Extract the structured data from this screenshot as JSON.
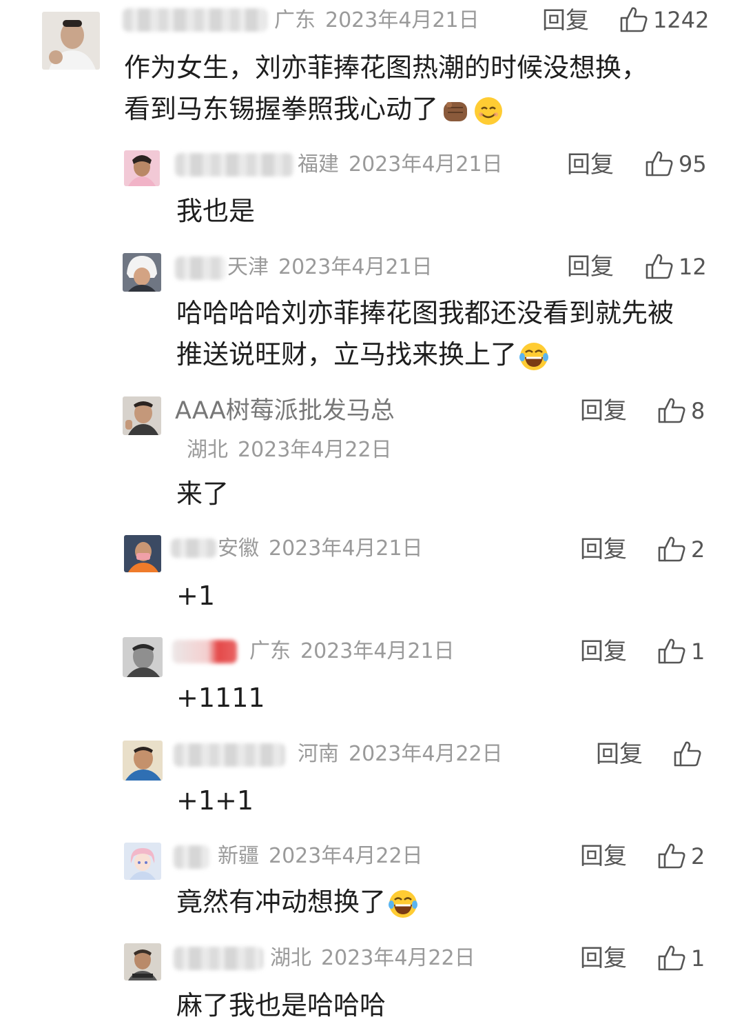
{
  "comments": [
    {
      "region": "广东",
      "date": "2023年4月21日",
      "reply": "回复",
      "likes": "1242",
      "lines": [
        "作为女生，刘亦菲捧花图热潮的时候没想换，",
        "看到马东锡握拳照我心动了"
      ],
      "emojis": [
        "fist-emoji",
        "smile-emoji"
      ]
    },
    {
      "region": "福建",
      "date": "2023年4月21日",
      "reply": "回复",
      "likes": "95",
      "lines": [
        "我也是"
      ]
    },
    {
      "region": "天津",
      "date": "2023年4月21日",
      "reply": "回复",
      "likes": "12",
      "lines": [
        "哈哈哈哈刘亦菲捧花图我都还没看到就先被",
        "推送说旺财，立马找来换上了"
      ],
      "emojis": [
        "laugh-cry-emoji"
      ]
    },
    {
      "name": "AAA树莓派批发马总",
      "region": "湖北",
      "date": "2023年4月22日",
      "reply": "回复",
      "likes": "8",
      "lines": [
        "来了"
      ]
    },
    {
      "region": "安徽",
      "date": "2023年4月21日",
      "reply": "回复",
      "likes": "2",
      "lines": [
        "+1"
      ]
    },
    {
      "region": "广东",
      "date": "2023年4月21日",
      "reply": "回复",
      "likes": "1",
      "lines": [
        "+1111"
      ]
    },
    {
      "region": "河南",
      "date": "2023年4月22日",
      "reply": "回复",
      "likes": "",
      "lines": [
        "+1+1"
      ]
    },
    {
      "region": "新疆",
      "date": "2023年4月22日",
      "reply": "回复",
      "likes": "2",
      "lines": [
        "竟然有冲动想换了"
      ],
      "emojis": [
        "laugh-cry-emoji"
      ]
    },
    {
      "region": "湖北",
      "date": "2023年4月22日",
      "reply": "回复",
      "likes": "1",
      "lines": [
        "麻了我也是哈哈哈"
      ]
    }
  ],
  "icons": {
    "like": "thumbs-up-icon",
    "avatar": "user-avatar"
  },
  "colors": {
    "meta": "#9a9a9a",
    "text": "#1e1e1e",
    "action": "#555555"
  }
}
